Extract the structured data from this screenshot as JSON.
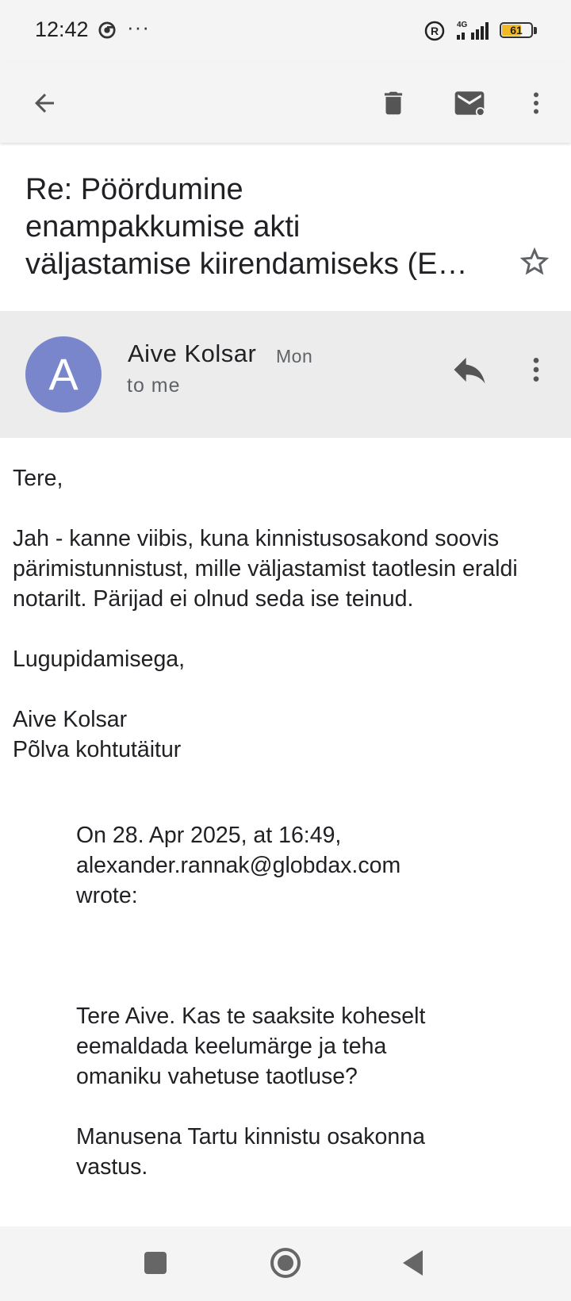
{
  "status_bar": {
    "time": "12:42",
    "more": "···",
    "network": "4G",
    "battery": "61",
    "battery_color": "#f2b825"
  },
  "toolbar": {
    "back_icon": "arrow-back-icon",
    "delete_icon": "trash-icon",
    "mark_unread_icon": "mail-unread-icon",
    "more_icon": "more-vert-icon"
  },
  "email": {
    "subject_lines": [
      "Re: Pöördumine",
      "enampakkumise akti",
      "väljastamise kiirendamiseks (E…"
    ],
    "sender": {
      "avatar_letter": "A",
      "avatar_color": "#7986cb",
      "name": "Aive Kolsar",
      "date": "Mon",
      "recipient": "to me"
    },
    "body": {
      "greeting": "Tere,",
      "paragraph": "Jah - kanne viibis, kuna kinnistusosakond soovis pärimistunnistust, mille väljastamist taotlesin eraldi notarilt. Pärijad ei olnud seda ise teinud.",
      "closing": "Lugupidamisega,",
      "signature_name": "Aive Kolsar",
      "signature_title": "Põlva kohtutäitur"
    },
    "quoted": {
      "header_line1": "On 28. Apr 2025, at 16:49,",
      "header_line2": "alexander.rannak@globdax.com",
      "header_line3": "wrote:",
      "text_line1": "Tere Aive. Kas te saaksite koheselt",
      "text_line2": "eemaldada keelumärge ja teha",
      "text_line3": "omaniku vahetuse taotluse?",
      "text2_line1": "Manusena Tartu kinnistu osakonna",
      "text2_line2": "vastus."
    }
  }
}
